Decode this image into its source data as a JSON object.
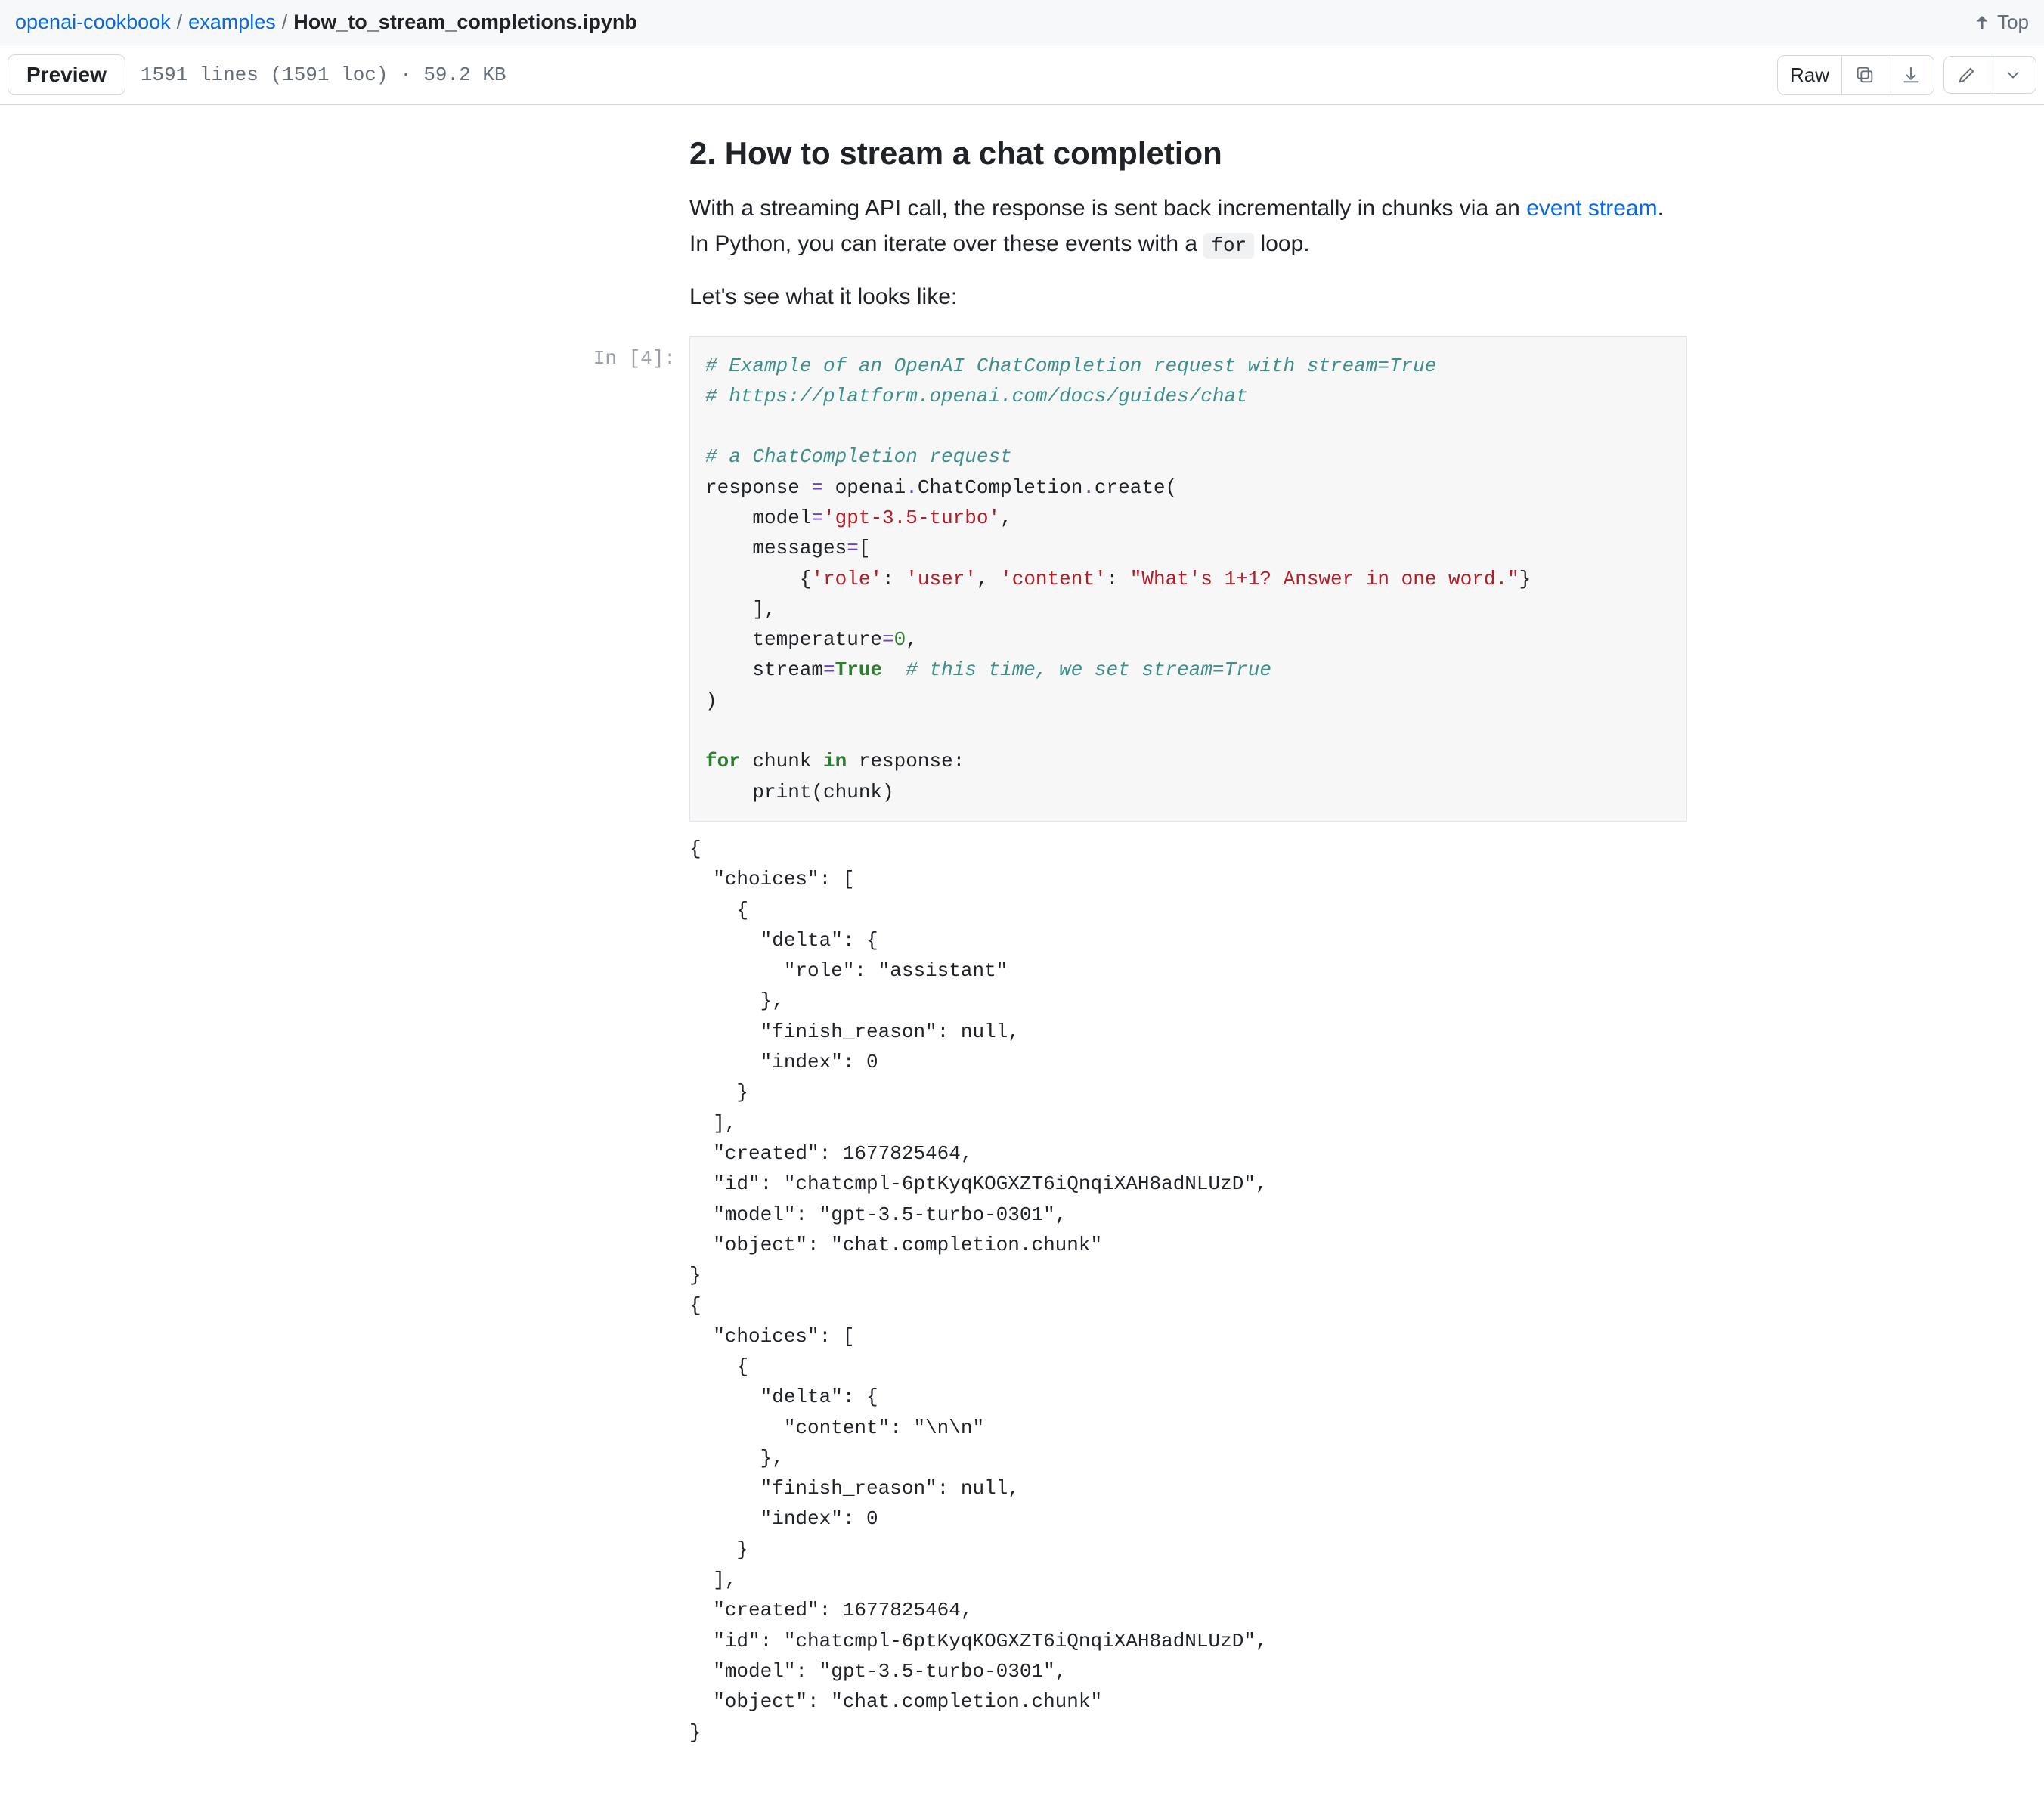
{
  "breadcrumb": {
    "repo": "openai-cookbook",
    "folder": "examples",
    "file": "How_to_stream_completions.ipynb",
    "sep": "/"
  },
  "top_link": "Top",
  "toolbar": {
    "preview_label": "Preview",
    "file_meta": "1591 lines (1591 loc) · 59.2 KB",
    "raw_label": "Raw"
  },
  "doc": {
    "heading": "2. How to stream a chat completion",
    "para1_a": "With a streaming API call, the response is sent back incrementally in chunks via an ",
    "para1_link": "event stream",
    "para1_b": ". In Python, you can iterate over these events with a ",
    "para1_code": "for",
    "para1_c": " loop.",
    "para2": "Let's see what it looks like:"
  },
  "cell": {
    "prompt": "In [4]:",
    "code": {
      "c1": "# Example of an OpenAI ChatCompletion request with stream=True",
      "c2": "# https://platform.openai.com/docs/guides/chat",
      "c3": "# a ChatCompletion request",
      "l4a": "response ",
      "l4b": "=",
      "l4c": " openai",
      "l4d": ".",
      "l4e": "ChatCompletion",
      "l4f": ".",
      "l4g": "create(",
      "l5a": "    model",
      "l5b": "=",
      "l5c": "'gpt-3.5-turbo'",
      "l5d": ",",
      "l6a": "    messages",
      "l6b": "=",
      "l6c": "[",
      "l7a": "        {",
      "l7b": "'role'",
      "l7c": ": ",
      "l7d": "'user'",
      "l7e": ", ",
      "l7f": "'content'",
      "l7g": ": ",
      "l7h": "\"What's 1+1? Answer in one word.\"",
      "l7i": "}",
      "l8a": "    ],",
      "l9a": "    temperature",
      "l9b": "=",
      "l9c": "0",
      "l9d": ",",
      "l10a": "    stream",
      "l10b": "=",
      "l10c": "True",
      "l10d": "  ",
      "l10e": "# this time, we set stream=True",
      "l11a": ")",
      "l12a": "for",
      "l12b": " chunk ",
      "l12c": "in",
      "l12d": " response:",
      "l13a": "    print(chunk)"
    },
    "output": "{\n  \"choices\": [\n    {\n      \"delta\": {\n        \"role\": \"assistant\"\n      },\n      \"finish_reason\": null,\n      \"index\": 0\n    }\n  ],\n  \"created\": 1677825464,\n  \"id\": \"chatcmpl-6ptKyqKOGXZT6iQnqiXAH8adNLUzD\",\n  \"model\": \"gpt-3.5-turbo-0301\",\n  \"object\": \"chat.completion.chunk\"\n}\n{\n  \"choices\": [\n    {\n      \"delta\": {\n        \"content\": \"\\n\\n\"\n      },\n      \"finish_reason\": null,\n      \"index\": 0\n    }\n  ],\n  \"created\": 1677825464,\n  \"id\": \"chatcmpl-6ptKyqKOGXZT6iQnqiXAH8adNLUzD\",\n  \"model\": \"gpt-3.5-turbo-0301\",\n  \"object\": \"chat.completion.chunk\"\n}"
  }
}
